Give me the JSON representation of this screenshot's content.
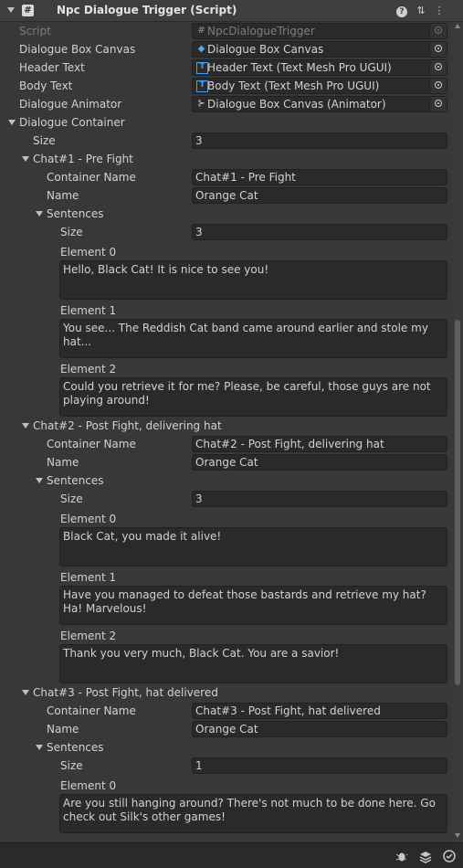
{
  "header": {
    "title": "Npc Dialogue Trigger (Script)",
    "icons": [
      "script-icon",
      "help-icon",
      "preset-icon",
      "kebab-menu-icon"
    ]
  },
  "fields": {
    "script": {
      "label": "Script",
      "value": "NpcDialogueTrigger"
    },
    "dialogue_box_canvas": {
      "label": "Dialogue Box Canvas",
      "value": "Dialogue Box Canvas"
    },
    "header_text": {
      "label": "Header Text",
      "value": "Header Text (Text Mesh Pro UGUI)"
    },
    "body_text": {
      "label": "Body Text",
      "value": "Body Text (Text Mesh Pro UGUI)"
    },
    "dialogue_animator": {
      "label": "Dialogue Animator",
      "value": "Dialogue Box Canvas (Animator)"
    }
  },
  "container": {
    "label": "Dialogue Container",
    "size_label": "Size",
    "size": "3",
    "chats": [
      {
        "title": "Chat#1 - Pre Fight",
        "container_name_label": "Container Name",
        "container_name": "Chat#1 - Pre Fight",
        "name_label": "Name",
        "name": "Orange Cat",
        "sentences_label": "Sentences",
        "size_label": "Size",
        "size": "3",
        "elements": [
          {
            "label": "Element 0",
            "text": "Hello, Black Cat! It is nice to see you!"
          },
          {
            "label": "Element 1",
            "text": "You see... The Reddish Cat band came around earlier and stole my hat..."
          },
          {
            "label": "Element 2",
            "text": "Could you retrieve it for me? Please, be careful, those guys are not playing around!"
          }
        ]
      },
      {
        "title": "Chat#2 - Post Fight, delivering hat",
        "container_name_label": "Container Name",
        "container_name": "Chat#2 - Post Fight, delivering hat",
        "name_label": "Name",
        "name": "Orange Cat",
        "sentences_label": "Sentences",
        "size_label": "Size",
        "size": "3",
        "elements": [
          {
            "label": "Element 0",
            "text": "Black Cat, you made it alive!"
          },
          {
            "label": "Element 1",
            "text": "Have you managed to defeat those bastards and retrieve my hat? Ha! Marvelous!"
          },
          {
            "label": "Element 2",
            "text": "Thank you very much, Black Cat. You are a savior!"
          }
        ]
      },
      {
        "title": "Chat#3 - Post Fight, hat delivered",
        "container_name_label": "Container Name",
        "container_name": "Chat#3 - Post Fight, hat delivered",
        "name_label": "Name",
        "name": "Orange Cat",
        "sentences_label": "Sentences",
        "size_label": "Size",
        "size": "1",
        "elements": [
          {
            "label": "Element 0",
            "text": "Are you still hanging around? There's not much to be done here. Go check out Silk's other games!"
          }
        ]
      }
    ]
  },
  "statusbar": {
    "icons": [
      "debug-icon",
      "layers-icon",
      "check-circle-icon"
    ]
  }
}
